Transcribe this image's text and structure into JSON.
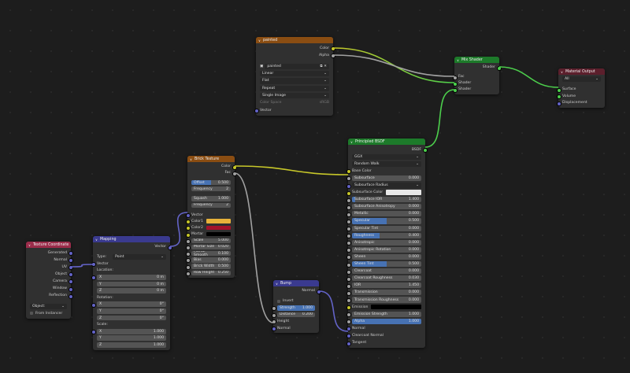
{
  "colors": {
    "yellow": "#c7c729",
    "grey": "#a1a1a1",
    "green": "#4ccf4c",
    "purple": "#6363c7",
    "shader_hdr": "#1d7a2a",
    "texture_hdr": "#8a4d12",
    "vector_hdr": "#3a3a8f",
    "input_hdr": "#9b2c4a",
    "output_hdr": "#5c1f2c"
  },
  "nodes": [
    {
      "id": "image",
      "title": "painted",
      "hdr": "texture_hdr",
      "rows": [
        {
          "k": "out",
          "label": "Color",
          "s": "yellow"
        },
        {
          "k": "out",
          "label": "Alpha",
          "s": "grey"
        },
        {
          "k": "sp"
        },
        {
          "k": "sel",
          "label": "painted",
          "icon": "image-icon"
        },
        {
          "k": "sel",
          "label": "Linear"
        },
        {
          "k": "sel",
          "label": "Flat"
        },
        {
          "k": "sel",
          "label": "Repeat"
        },
        {
          "k": "sel",
          "label": "Single Image"
        },
        {
          "k": "dim",
          "label": "Color Space",
          "value": "sRGB"
        },
        {
          "k": "in",
          "label": "Vector",
          "s": "purple"
        }
      ]
    },
    {
      "id": "mix",
      "title": "Mix Shader",
      "hdr": "shader_hdr",
      "rows": [
        {
          "k": "out",
          "label": "Shader",
          "s": "green"
        },
        {
          "k": "sp"
        },
        {
          "k": "in",
          "label": "Fac",
          "s": "grey"
        },
        {
          "k": "in",
          "label": "Shader",
          "s": "green"
        },
        {
          "k": "in",
          "label": "Shader",
          "s": "green"
        }
      ]
    },
    {
      "id": "matout",
      "title": "Material Output",
      "hdr": "output_hdr",
      "rows": [
        {
          "k": "sel",
          "label": "All"
        },
        {
          "k": "sp"
        },
        {
          "k": "in",
          "label": "Surface",
          "s": "green"
        },
        {
          "k": "in",
          "label": "Volume",
          "s": "green"
        },
        {
          "k": "in",
          "label": "Displacement",
          "s": "purple"
        }
      ]
    },
    {
      "id": "bsdf",
      "title": "Principled BSDF",
      "hdr": "shader_hdr",
      "rows": [
        {
          "k": "out",
          "label": "BSDF",
          "s": "green"
        },
        {
          "k": "sel",
          "label": "GGX"
        },
        {
          "k": "sel",
          "label": "Random Walk"
        },
        {
          "k": "in",
          "label": "Base Color",
          "s": "yellow"
        },
        {
          "k": "fld",
          "label": "Subsurface",
          "value": "0.000",
          "s": "grey"
        },
        {
          "k": "sel",
          "label": "Subsurface Radius",
          "s": "purple"
        },
        {
          "k": "col",
          "label": "Subsurface Color",
          "color": "#e8e8e8",
          "s": "yellow"
        },
        {
          "k": "fld",
          "label": "Subsurface IOR",
          "value": "1.400",
          "fill": 0.05,
          "s": "grey"
        },
        {
          "k": "fld",
          "label": "Subsurface Anisotropy",
          "value": "0.000",
          "s": "grey"
        },
        {
          "k": "fld",
          "label": "Metallic",
          "value": "0.000",
          "s": "grey"
        },
        {
          "k": "fld",
          "label": "Specular",
          "value": "0.500",
          "fill": 0.5,
          "s": "grey"
        },
        {
          "k": "fld",
          "label": "Specular Tint",
          "value": "0.000",
          "s": "grey"
        },
        {
          "k": "fld",
          "label": "Roughness",
          "value": "0.400",
          "fill": 0.4,
          "s": "grey"
        },
        {
          "k": "fld",
          "label": "Anisotropic",
          "value": "0.000",
          "s": "grey"
        },
        {
          "k": "fld",
          "label": "Anisotropic Rotation",
          "value": "0.000",
          "s": "grey"
        },
        {
          "k": "fld",
          "label": "Sheen",
          "value": "0.000",
          "s": "grey"
        },
        {
          "k": "fld",
          "label": "Sheen Tint",
          "value": "0.500",
          "fill": 0.5,
          "s": "grey"
        },
        {
          "k": "fld",
          "label": "Clearcoat",
          "value": "0.000",
          "s": "grey"
        },
        {
          "k": "fld",
          "label": "Clearcoat Roughness",
          "value": "0.030",
          "s": "grey"
        },
        {
          "k": "fld",
          "label": "IOR",
          "value": "1.450",
          "s": "grey"
        },
        {
          "k": "fld",
          "label": "Transmission",
          "value": "0.000",
          "s": "grey"
        },
        {
          "k": "fld",
          "label": "Transmission Roughness",
          "value": "0.000",
          "s": "grey"
        },
        {
          "k": "col",
          "label": "Emission",
          "color": "#000000",
          "s": "yellow"
        },
        {
          "k": "fld",
          "label": "Emission Strength",
          "value": "1.000",
          "s": "grey"
        },
        {
          "k": "fld",
          "label": "Alpha",
          "value": "1.000",
          "fill": 1,
          "s": "grey"
        },
        {
          "k": "in",
          "label": "Normal",
          "s": "purple"
        },
        {
          "k": "in",
          "label": "Clearcoat Normal",
          "s": "purple"
        },
        {
          "k": "in",
          "label": "Tangent",
          "s": "purple"
        }
      ]
    },
    {
      "id": "brick",
      "title": "Brick Texture",
      "hdr": "texture_hdr",
      "rows": [
        {
          "k": "out",
          "label": "Color",
          "s": "yellow"
        },
        {
          "k": "out",
          "label": "Fac",
          "s": "grey"
        },
        {
          "k": "sp"
        },
        {
          "k": "fld",
          "label": "Offset",
          "value": "0.500",
          "fill": 0.5
        },
        {
          "k": "fld",
          "label": "Frequency",
          "value": "2"
        },
        {
          "k": "sp"
        },
        {
          "k": "fld",
          "label": "Squash",
          "value": "1.000"
        },
        {
          "k": "fld",
          "label": "Frequency",
          "value": "2"
        },
        {
          "k": "sp"
        },
        {
          "k": "in",
          "label": "Vector",
          "s": "purple"
        },
        {
          "k": "col",
          "label": "Color1",
          "color": "#e8b23a",
          "s": "yellow"
        },
        {
          "k": "col",
          "label": "Color2",
          "color": "#a3122a",
          "s": "yellow"
        },
        {
          "k": "col",
          "label": "Mortar",
          "color": "#000000",
          "s": "yellow"
        },
        {
          "k": "fld",
          "label": "Scale",
          "value": "5.000",
          "s": "grey"
        },
        {
          "k": "fld",
          "label": "Mortar Size",
          "value": "0.020",
          "s": "grey"
        },
        {
          "k": "fld",
          "label": "Mortar Smooth",
          "value": "0.100",
          "s": "grey"
        },
        {
          "k": "fld",
          "label": "Bias",
          "value": "0.000",
          "s": "grey"
        },
        {
          "k": "fld",
          "label": "Brick Width",
          "value": "0.500",
          "s": "grey"
        },
        {
          "k": "fld",
          "label": "Row Height",
          "value": "0.250",
          "s": "grey"
        }
      ]
    },
    {
      "id": "texcoord",
      "title": "Texture Coordinate",
      "hdr": "input_hdr",
      "rows": [
        {
          "k": "out",
          "label": "Generated",
          "s": "purple"
        },
        {
          "k": "out",
          "label": "Normal",
          "s": "purple"
        },
        {
          "k": "out",
          "label": "UV",
          "s": "purple"
        },
        {
          "k": "out",
          "label": "Object",
          "s": "purple"
        },
        {
          "k": "out",
          "label": "Camera",
          "s": "purple"
        },
        {
          "k": "out",
          "label": "Window",
          "s": "purple"
        },
        {
          "k": "out",
          "label": "Reflection",
          "s": "purple"
        },
        {
          "k": "sp"
        },
        {
          "k": "sel",
          "label": "Object:",
          "value": ""
        },
        {
          "k": "chk",
          "label": "From Instancer"
        }
      ]
    },
    {
      "id": "mapping",
      "title": "Mapping",
      "hdr": "vector_hdr",
      "rows": [
        {
          "k": "out",
          "label": "Vector",
          "s": "purple"
        },
        {
          "k": "sp"
        },
        {
          "k": "sel",
          "label": "Point",
          "pre": "Type:"
        },
        {
          "k": "in",
          "label": "Vector",
          "s": "purple"
        },
        {
          "k": "lab",
          "label": "Location:"
        },
        {
          "k": "fld",
          "label": "X",
          "value": "0 m",
          "s": "purple"
        },
        {
          "k": "fld",
          "label": "Y",
          "value": "0 m"
        },
        {
          "k": "fld",
          "label": "Z",
          "value": "0 m"
        },
        {
          "k": "lab",
          "label": "Rotation:"
        },
        {
          "k": "fld",
          "label": "X",
          "value": "0°",
          "s": "purple"
        },
        {
          "k": "fld",
          "label": "Y",
          "value": "0°"
        },
        {
          "k": "fld",
          "label": "Z",
          "value": "0°"
        },
        {
          "k": "lab",
          "label": "Scale:"
        },
        {
          "k": "fld",
          "label": "X",
          "value": "1.000",
          "s": "purple"
        },
        {
          "k": "fld",
          "label": "Y",
          "value": "1.000"
        },
        {
          "k": "fld",
          "label": "Z",
          "value": "1.000"
        }
      ]
    },
    {
      "id": "bump",
      "title": "Bump",
      "hdr": "vector_hdr",
      "rows": [
        {
          "k": "out",
          "label": "Normal",
          "s": "purple"
        },
        {
          "k": "sp"
        },
        {
          "k": "chk",
          "label": "Invert"
        },
        {
          "k": "fld",
          "label": "Strength",
          "value": "1.000",
          "fill": 1,
          "s": "grey"
        },
        {
          "k": "fld",
          "label": "Distance",
          "value": "0.200",
          "s": "grey"
        },
        {
          "k": "in",
          "label": "Height",
          "s": "grey"
        },
        {
          "k": "in",
          "label": "Normal",
          "s": "purple"
        }
      ]
    }
  ]
}
